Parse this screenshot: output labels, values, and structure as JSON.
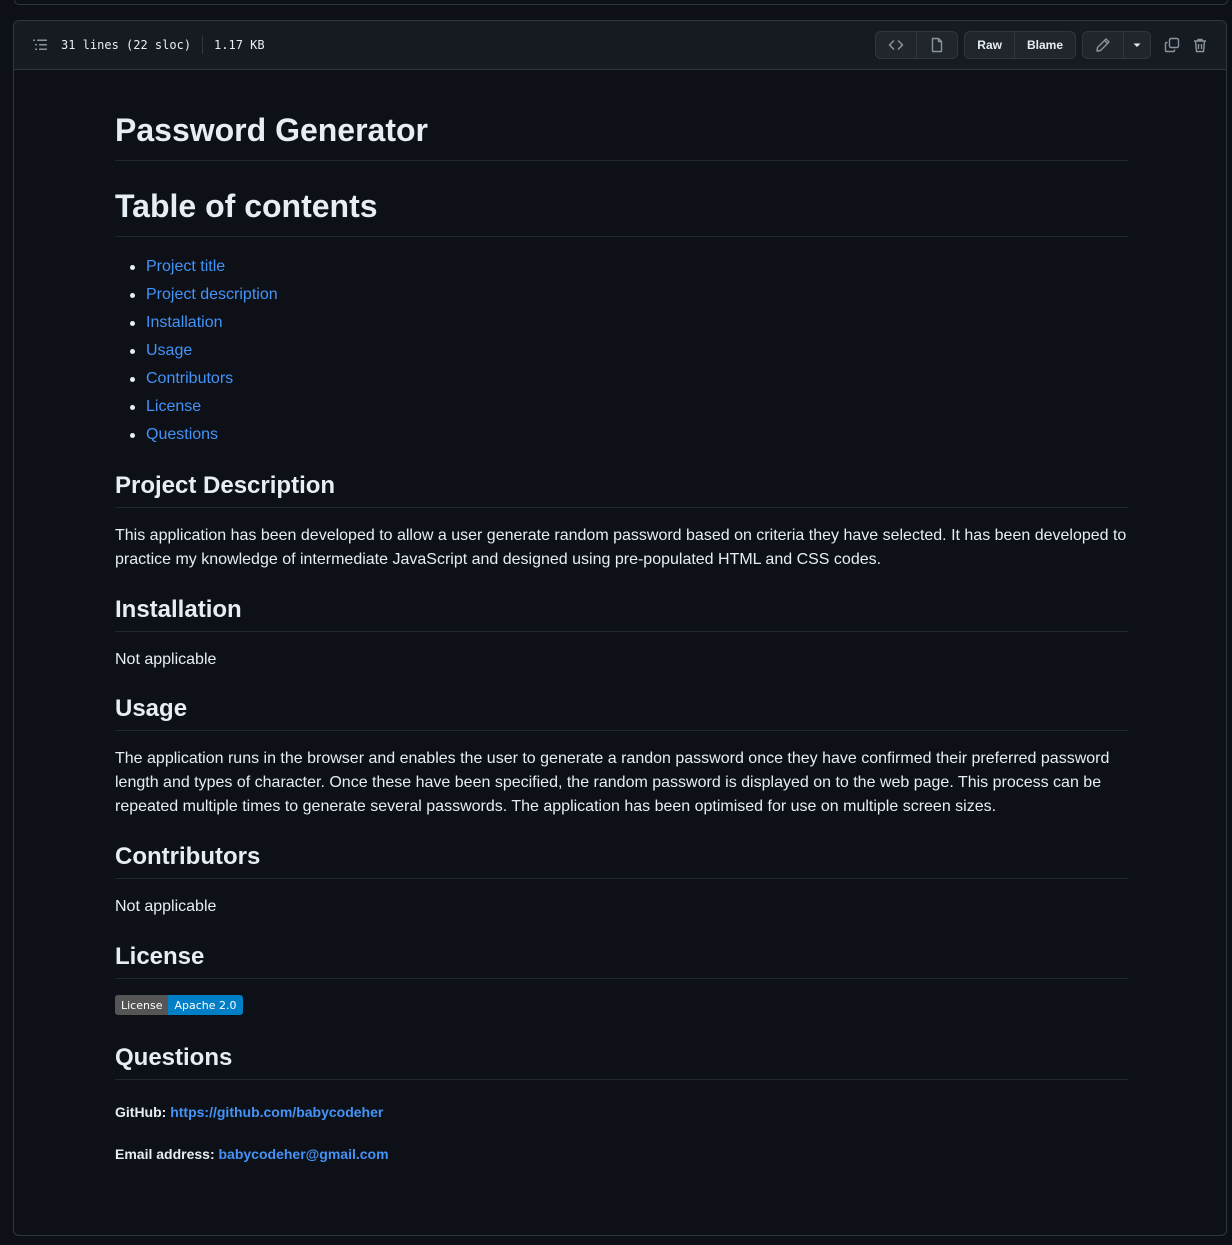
{
  "file": {
    "lines": "31 lines (22 sloc)",
    "size": "1.17 KB"
  },
  "toolbar": {
    "raw_label": "Raw",
    "blame_label": "Blame"
  },
  "readme": {
    "title": "Password Generator",
    "toc_heading": "Table of contents",
    "toc": [
      "Project title",
      "Project description",
      "Installation",
      "Usage",
      "Contributors",
      "License",
      "Questions"
    ],
    "sections": {
      "description": {
        "heading": "Project Description",
        "text": "This application has been developed to allow a user generate random password based on criteria they have selected. It has been developed to practice my knowledge of intermediate JavaScript and designed using pre-populated HTML and CSS codes."
      },
      "installation": {
        "heading": "Installation",
        "text": "Not applicable"
      },
      "usage": {
        "heading": "Usage",
        "text": "The application runs in the browser and enables the user to generate a randon password once they have confirmed their preferred password length and types of character. Once these have been specified, the random password is displayed on to the web page. This process can be repeated multiple times to generate several passwords. The application has been optimised for use on multiple screen sizes."
      },
      "contributors": {
        "heading": "Contributors",
        "text": "Not applicable"
      },
      "license": {
        "heading": "License",
        "badge_left": "License",
        "badge_right": "Apache 2.0"
      },
      "questions": {
        "heading": "Questions",
        "github_label": "GitHub:",
        "github_link": "https://github.com/babycodeher",
        "email_label": "Email address:",
        "email_link": "babycodeher@gmail.com"
      }
    }
  },
  "colors": {
    "background": "#0d1117",
    "header": "#161b22",
    "border": "#30363d",
    "link": "#4493f8",
    "text": "#e6edf3",
    "badge_left": "#555555",
    "badge_right": "#007ec6"
  }
}
